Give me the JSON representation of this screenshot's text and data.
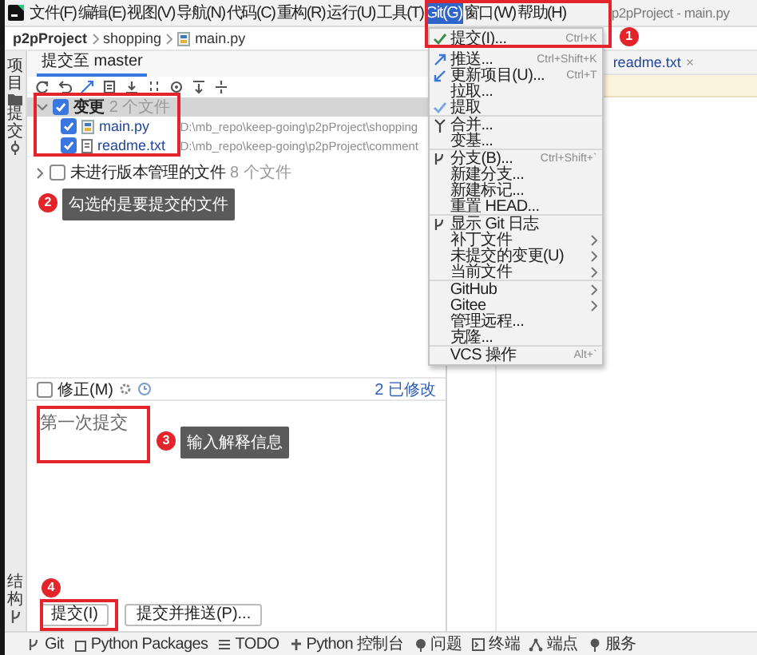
{
  "menu_bar": {
    "items": [
      {
        "label": "文件(F)",
        "selected": false
      },
      {
        "label": "编辑(E)",
        "selected": false
      },
      {
        "label": "视图(V)",
        "selected": false
      },
      {
        "label": "导航(N)",
        "selected": false
      },
      {
        "label": "代码(C)",
        "selected": false
      },
      {
        "label": "重构(R)",
        "selected": false
      },
      {
        "label": "运行(U)",
        "selected": false
      },
      {
        "label": "工具(T)",
        "selected": false
      },
      {
        "label": "Git(G)",
        "selected": true
      },
      {
        "label": "窗口(W)",
        "selected": false
      },
      {
        "label": "帮助(H)",
        "selected": false
      }
    ]
  },
  "window_title": "p2pProject - main.py",
  "breadcrumb": [
    "p2pProject",
    "shopping",
    "main.py"
  ],
  "git_menu": {
    "groups": [
      [
        {
          "label": "提交(I)...",
          "shortcut": "Ctrl+K"
        },
        {
          "label": "推送...",
          "shortcut": "Ctrl+Shift+K"
        },
        {
          "label": "更新项目(U)...",
          "shortcut": "Ctrl+T"
        },
        {
          "label": "拉取..."
        },
        {
          "label": "提取"
        }
      ],
      [
        {
          "label": "合并..."
        },
        {
          "label": "变基..."
        }
      ],
      [
        {
          "label": "分支(B)...",
          "shortcut": "Ctrl+Shift+`"
        },
        {
          "label": "新建分支..."
        },
        {
          "label": "新建标记..."
        },
        {
          "label": "重置 HEAD..."
        }
      ],
      [
        {
          "label": "显示 Git 日志"
        },
        {
          "label": "补丁文件",
          "submenu": true
        },
        {
          "label": "未提交的变更(U)",
          "submenu": true
        },
        {
          "label": "当前文件",
          "submenu": true
        }
      ],
      [
        {
          "label": "GitHub",
          "submenu": true
        },
        {
          "label": "Gitee",
          "submenu": true
        },
        {
          "label": "管理远程..."
        },
        {
          "label": "克隆..."
        }
      ],
      [
        {
          "label": "VCS 操作",
          "shortcut": "Alt+`"
        }
      ]
    ]
  },
  "tool_strip": {
    "top": [
      "项目",
      "提交"
    ],
    "bottom": [
      "结构"
    ]
  },
  "commit_panel": {
    "tab": "提交至 master",
    "tree": [
      {
        "label": "变更",
        "count": "2 个文件",
        "checked": true,
        "expanded": true,
        "selected": true,
        "children": [
          {
            "label": "main.py",
            "path": "D:\\mb_repo\\keep-going\\p2pProject\\shopping",
            "checked": true,
            "selected": false,
            "kind": "python"
          },
          {
            "label": "readme.txt",
            "path": "D:\\mb_repo\\keep-going\\p2pProject\\comment",
            "checked": true,
            "selected": false,
            "kind": "text"
          }
        ]
      },
      {
        "label": "未进行版本管理的文件",
        "count": "8 个文件",
        "checked": false,
        "expanded": false,
        "selected": false
      }
    ],
    "amend": {
      "label": "修正(M)",
      "checked": false
    },
    "modified": "2 已修改",
    "message": "第一次提交",
    "buttons": [
      "提交(I)",
      "提交并推送(P)..."
    ]
  },
  "editor": {
    "tab": "readme.txt",
    "close": "×"
  },
  "status_bar": [
    "Git",
    "Python Packages",
    "TODO",
    "Python 控制台",
    "问题",
    "终端",
    "端点",
    "服务"
  ],
  "annotations": [
    {
      "number": "1"
    },
    {
      "number": "2",
      "note": "勾选的是要提交的文件"
    },
    {
      "number": "3",
      "note": "输入解释信息"
    },
    {
      "number": "4"
    }
  ]
}
